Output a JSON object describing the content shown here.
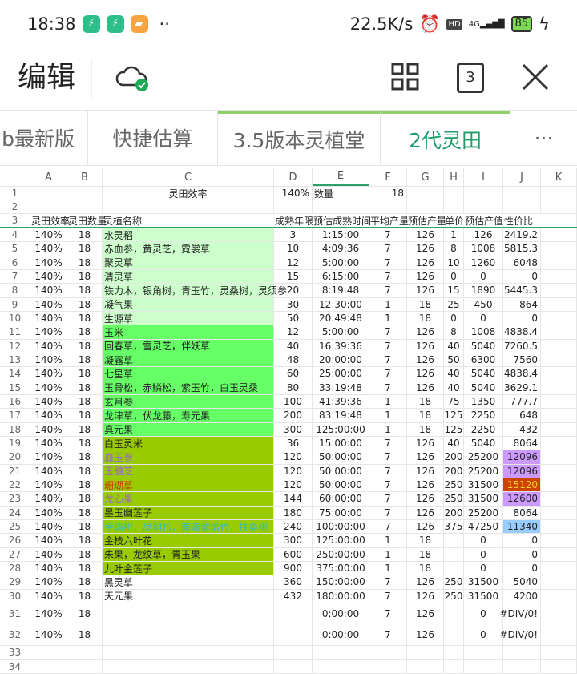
{
  "status": {
    "time": "18:38",
    "net_speed": "22.5K/s",
    "hd": "HD",
    "signal": "4G",
    "battery": "85"
  },
  "toolbar": {
    "title": "编辑",
    "sheet_count": "3"
  },
  "tabs": [
    {
      "label": "b最新版"
    },
    {
      "label": "快捷估算"
    },
    {
      "label": "3.5版本灵植堂"
    },
    {
      "label": "2代灵田",
      "active": true
    },
    {
      "label": "···"
    }
  ],
  "columns": [
    "A",
    "B",
    "C",
    "D",
    "E",
    "F",
    "G",
    "H",
    "I",
    "J",
    "K"
  ],
  "row1": {
    "c": "灵田效率",
    "d": "140%",
    "e": "数量",
    "f": "18"
  },
  "headers": [
    "灵田效率",
    "灵田数量",
    "灵植名称",
    "成熟年限",
    "预估成熟时间",
    "平均产量",
    "预估产量",
    "单价",
    "预估产值",
    "性价比"
  ],
  "rows": [
    [
      "140%",
      "18",
      "水灵稻",
      "3",
      "1:15:00",
      "7",
      "126",
      "1",
      "126",
      "2419.2"
    ],
    [
      "140%",
      "18",
      "赤血参，黄灵芝，霓裳草",
      "10",
      "4:09:36",
      "7",
      "126",
      "8",
      "1008",
      "5815.3"
    ],
    [
      "140%",
      "18",
      "聚灵草",
      "12",
      "5:00:00",
      "7",
      "126",
      "10",
      "1260",
      "6048"
    ],
    [
      "140%",
      "18",
      "清灵草",
      "15",
      "6:15:00",
      "7",
      "126",
      "0",
      "0",
      "0"
    ],
    [
      "140%",
      "18",
      "铁力木，银角树，青玉竹，灵桑树，灵须参",
      "20",
      "8:19:48",
      "7",
      "126",
      "15",
      "1890",
      "5445.3"
    ],
    [
      "140%",
      "18",
      "凝气果",
      "30",
      "12:30:00",
      "1",
      "18",
      "25",
      "450",
      "864"
    ],
    [
      "140%",
      "18",
      "生源草",
      "50",
      "20:49:48",
      "1",
      "18",
      "0",
      "0",
      "0"
    ],
    [
      "140%",
      "18",
      "玉米",
      "12",
      "5:00:00",
      "7",
      "126",
      "8",
      "1008",
      "4838.4"
    ],
    [
      "140%",
      "18",
      "回春草，雪灵芝，伴妖草",
      "40",
      "16:39:36",
      "7",
      "126",
      "40",
      "5040",
      "7260.5"
    ],
    [
      "140%",
      "18",
      "凝露草",
      "48",
      "20:00:00",
      "7",
      "126",
      "50",
      "6300",
      "7560"
    ],
    [
      "140%",
      "18",
      "七星草",
      "60",
      "25:00:00",
      "7",
      "126",
      "40",
      "5040",
      "4838.4"
    ],
    [
      "140%",
      "18",
      "玉骨松，赤鳞松，紫玉竹，白玉灵桑",
      "80",
      "33:19:48",
      "7",
      "126",
      "40",
      "5040",
      "3629.1"
    ],
    [
      "140%",
      "18",
      "玄月参",
      "100",
      "41:39:36",
      "1",
      "18",
      "75",
      "1350",
      "777.7"
    ],
    [
      "140%",
      "18",
      "龙津草，伏龙藤，寿元果",
      "200",
      "83:19:48",
      "1",
      "18",
      "125",
      "2250",
      "648"
    ],
    [
      "140%",
      "18",
      "真元果",
      "300",
      "125:00:00",
      "1",
      "18",
      "125",
      "2250",
      "432"
    ],
    [
      "140%",
      "18",
      "白玉灵米",
      "36",
      "15:00:00",
      "7",
      "126",
      "40",
      "5040",
      "8064"
    ],
    [
      "140%",
      "18",
      "血玉参",
      "120",
      "50:00:00",
      "7",
      "126",
      "200",
      "25200",
      "12096"
    ],
    [
      "140%",
      "18",
      "玉髓芝",
      "120",
      "50:00:00",
      "7",
      "126",
      "200",
      "25200",
      "12096"
    ],
    [
      "140%",
      "18",
      "珊瑚草",
      "120",
      "50:00:00",
      "7",
      "126",
      "250",
      "31500",
      "15120"
    ],
    [
      "140%",
      "18",
      "龙心果",
      "144",
      "60:00:00",
      "7",
      "126",
      "250",
      "31500",
      "12600"
    ],
    [
      "140%",
      "18",
      "墨玉幽莲子",
      "180",
      "75:00:00",
      "7",
      "126",
      "200",
      "25200",
      "8064"
    ],
    [
      "140%",
      "18",
      "金瑙树，凤羽杉，南海紫焰竹，扶桑树",
      "240",
      "100:00:00",
      "7",
      "126",
      "375",
      "47250",
      "11340"
    ],
    [
      "140%",
      "18",
      "金枝六叶花",
      "300",
      "125:00:00",
      "1",
      "18",
      "",
      "0",
      "0"
    ],
    [
      "140%",
      "18",
      "朱果，龙纹草，青玉果",
      "600",
      "250:00:00",
      "1",
      "18",
      "",
      "0",
      "0"
    ],
    [
      "140%",
      "18",
      "九叶金莲子",
      "900",
      "375:00:00",
      "1",
      "18",
      "",
      "0",
      "0"
    ],
    [
      "140%",
      "18",
      "黑灵草",
      "360",
      "150:00:00",
      "7",
      "126",
      "250",
      "31500",
      "5040"
    ],
    [
      "140%",
      "18",
      "天元果",
      "432",
      "180:00:00",
      "7",
      "126",
      "250",
      "31500",
      "4200"
    ],
    [
      "140%",
      "18",
      "",
      "",
      "0:00:00",
      "7",
      "126",
      "",
      "0",
      "#DIV/0!"
    ],
    [
      "140%",
      "18",
      "",
      "",
      "0:00:00",
      "7",
      "126",
      "",
      "0",
      "#DIV/0!"
    ]
  ],
  "colors": {
    "accent": "#1f9d6a",
    "tier1": "#ccffcc",
    "tier2": "#66ff66",
    "tier3": "#99cc00",
    "purple_bg": "#cc99ff",
    "orange_bg": "#cc4400",
    "blue_bg": "#99ccff",
    "purple_text": "#9966cc",
    "red_text": "#cc3300",
    "cyan_text": "#33bbbb"
  }
}
